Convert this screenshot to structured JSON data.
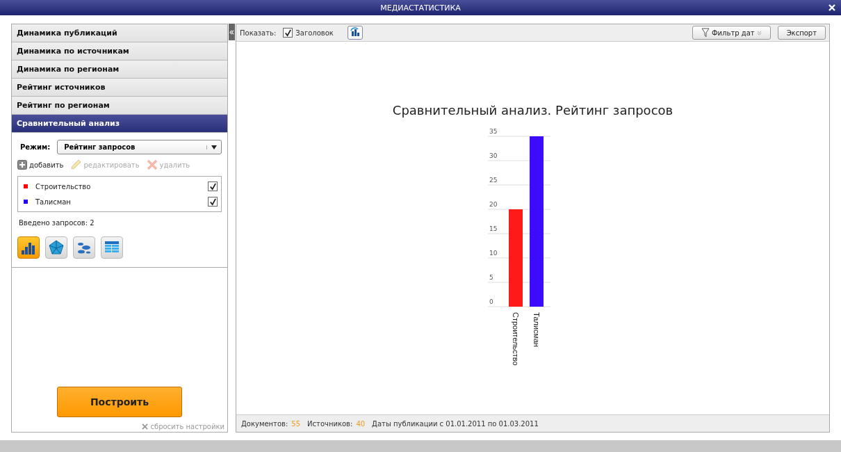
{
  "window": {
    "title": "МЕДИАСТАТИСТИКА"
  },
  "menu": [
    {
      "label": "Динамика публикаций",
      "selected": false
    },
    {
      "label": "Динамика по источникам",
      "selected": false
    },
    {
      "label": "Динамика по регионам",
      "selected": false
    },
    {
      "label": "Рейтинг источников",
      "selected": false
    },
    {
      "label": "Рейтинг по регионам",
      "selected": false
    },
    {
      "label": "Сравнительный анализ",
      "selected": true
    }
  ],
  "mode": {
    "label": "Режим:",
    "value": "Рейтинг запросов"
  },
  "actions": [
    {
      "kind": "add",
      "label": "добавить",
      "disabled": false
    },
    {
      "kind": "edit",
      "label": "редактировать",
      "disabled": true
    },
    {
      "kind": "delete",
      "label": "удалить",
      "disabled": true
    }
  ],
  "queries": [
    {
      "name": "Строительство",
      "color": "#ff0000",
      "checked": true
    },
    {
      "name": "Талисман",
      "color": "#2200ff",
      "checked": true
    }
  ],
  "query_count": "Введено запросов: 2",
  "chart_types": [
    {
      "kind": "bar",
      "selected": true
    },
    {
      "kind": "radar",
      "selected": false
    },
    {
      "kind": "bubble",
      "selected": false
    },
    {
      "kind": "table",
      "selected": false
    }
  ],
  "build_button": "Построить",
  "reset_link": "сбросить настройки",
  "toolbar": {
    "show_label": "Показать:",
    "header_checkbox": {
      "label": "Заголовок",
      "checked": true
    },
    "filter_button": "Фильтр дат",
    "export_button": "Экспорт"
  },
  "chart": {
    "title": "Сравнительный анализ. Рейтинг запросов",
    "chart_data": {
      "type": "bar",
      "categories": [
        "Строительство",
        "Талисман"
      ],
      "values": [
        20,
        35
      ],
      "grid": true,
      "colors": [
        "#ff1a1a",
        "#3d0cff"
      ],
      "ylim": [
        0,
        35
      ],
      "yticks": [
        0,
        5,
        10,
        15,
        20,
        25,
        30,
        35
      ]
    }
  },
  "status": [
    {
      "label": "Документов:",
      "value": "55"
    },
    {
      "label": "Источников:",
      "value": "40"
    },
    {
      "label": "Даты публикации с 01.01.2011 по 01.03.2011"
    }
  ]
}
